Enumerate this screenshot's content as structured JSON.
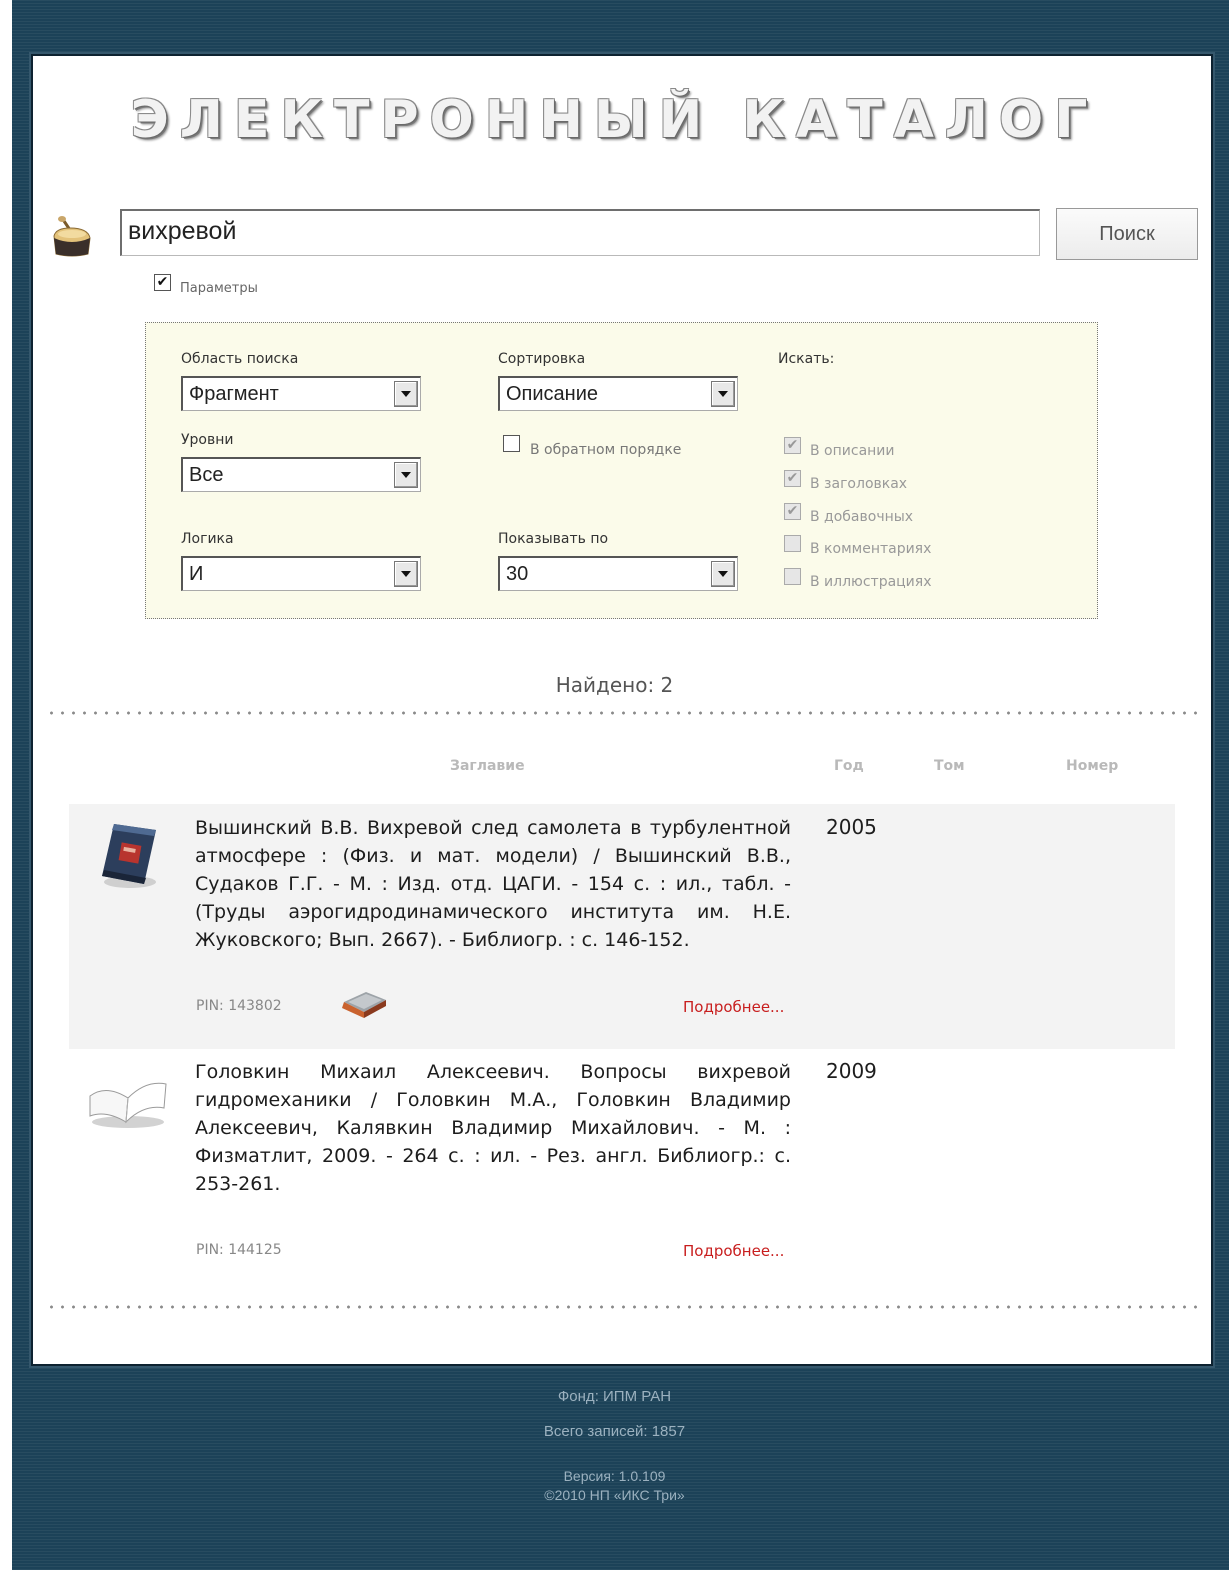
{
  "header": {
    "title": "ЭЛЕКТРОННЫЙ КАТАЛОГ"
  },
  "search": {
    "query": "вихревой",
    "button_label": "Поиск"
  },
  "params": {
    "toggle_label": "Параметры",
    "toggle_checked": true
  },
  "filters": {
    "area_label": "Область поиска",
    "area_value": "Фрагмент",
    "levels_label": "Уровни",
    "levels_value": "Все",
    "logic_label": "Логика",
    "logic_value": "И",
    "sort_label": "Сортировка",
    "sort_value": "Описание",
    "reverse_label": "В обратном порядке",
    "pagesize_label": "Показывать по",
    "pagesize_value": "30",
    "search_in_label": "Искать:",
    "search_in": [
      {
        "label": "В описании",
        "checked": true
      },
      {
        "label": "В заголовках",
        "checked": true
      },
      {
        "label": "В добавочных",
        "checked": true
      },
      {
        "label": "В комментариях",
        "checked": false
      },
      {
        "label": "В иллюстрациях",
        "checked": false
      }
    ]
  },
  "results": {
    "found_text": "Найдено: 2",
    "columns": {
      "title": "Заглавие",
      "year": "Год",
      "volume": "Том",
      "number": "Номер"
    },
    "items": [
      {
        "description": "Вышинский В.В. Вихревой след самолета в турбулентной атмосфере : (Физ. и мат. модели) / Вышинский В.В., Судаков Г.Г. - М. : Изд. отд. ЦАГИ. - 154 с. : ил., табл. - (Труды аэрогидродинамического института им. Н.Е. Жуковского; Вып. 2667). - Библиогр. : с. 146-152.",
        "year": "2005",
        "pin": "PIN: 143802",
        "more": "Подробнее...",
        "icon": "blue-book-icon"
      },
      {
        "description": "Головкин Михаил Алексеевич. Вопросы вихревой гидромеханики / Головкин М.А., Головкин Владимир Алексеевич, Калявкин Владимир Михайлович. - М. : Физматлит, 2009. - 264 с. : ил. - Рез. англ. Библиогр.: с. 253-261.",
        "year": "2009",
        "pin": "PIN: 144125",
        "more": "Подробнее...",
        "icon": "open-book-icon"
      }
    ]
  },
  "footer": {
    "fund": "Фонд: ИПМ РАН",
    "total": "Всего записей: 1857",
    "version": "Версия: 1.0.109",
    "copyright": "©2010 НП «ИКС Три»"
  }
}
